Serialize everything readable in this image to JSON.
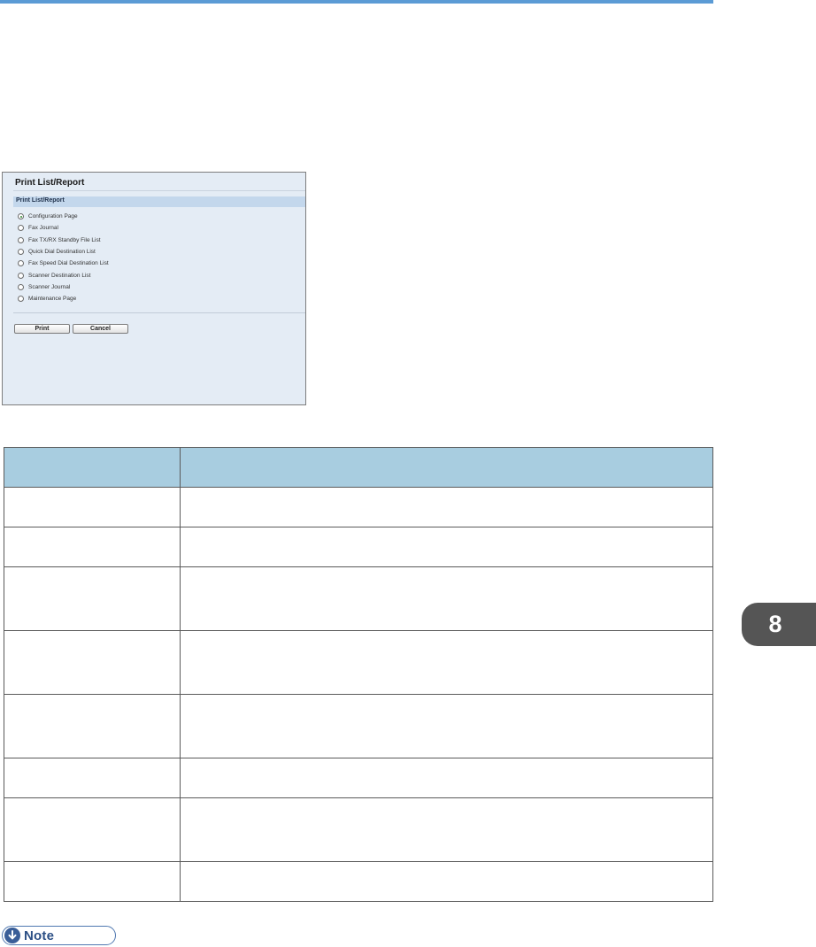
{
  "panel": {
    "title": "Print List/Report",
    "section_label": "Print List/Report",
    "options": [
      {
        "label": "Configuration Page",
        "selected": true
      },
      {
        "label": "Fax Journal",
        "selected": false
      },
      {
        "label": "Fax TX/RX Standby File List",
        "selected": false
      },
      {
        "label": "Quick Dial Destination List",
        "selected": false
      },
      {
        "label": "Fax Speed Dial Destination List",
        "selected": false
      },
      {
        "label": "Scanner Destination List",
        "selected": false
      },
      {
        "label": "Scanner Journal",
        "selected": false
      },
      {
        "label": "Maintenance Page",
        "selected": false
      }
    ],
    "print_label": "Print",
    "cancel_label": "Cancel"
  },
  "table": {
    "headers": [
      "",
      ""
    ],
    "rows": [
      [
        "",
        ""
      ],
      [
        "",
        ""
      ],
      [
        "",
        ""
      ],
      [
        "",
        ""
      ],
      [
        "",
        ""
      ],
      [
        "",
        ""
      ],
      [
        "",
        ""
      ],
      [
        "",
        ""
      ]
    ]
  },
  "chapter_tab": "8",
  "note_label": "Note",
  "colors": {
    "accent": "#5b9bd5",
    "table_header": "#a8cde0",
    "panel_bg": "#e4ecf5",
    "chapter_tab": "#555555",
    "note": "#3a5e98"
  }
}
